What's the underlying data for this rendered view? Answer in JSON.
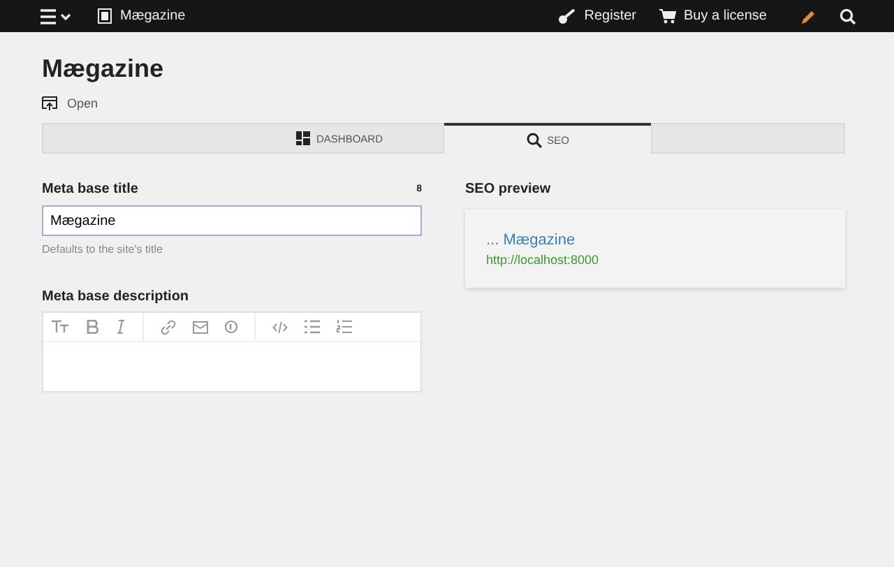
{
  "topbar": {
    "site": "Mægazine",
    "links": [
      "Register",
      "Buy a license"
    ]
  },
  "page": {
    "title": "Mægazine",
    "open_link": "Open"
  },
  "tabs": [
    {
      "label": "DASHBOARD",
      "selected": false
    },
    {
      "label": "SEO",
      "selected": true
    }
  ],
  "meta_title": {
    "label": "Meta base title",
    "count": "8",
    "value": "Mægazine",
    "hint": "Defaults to the site's title"
  },
  "meta_description": {
    "label": "Meta base description"
  },
  "seo_preview": {
    "heading": "SEO preview",
    "title": "... Mægazine",
    "url": "http://localhost:8000"
  }
}
